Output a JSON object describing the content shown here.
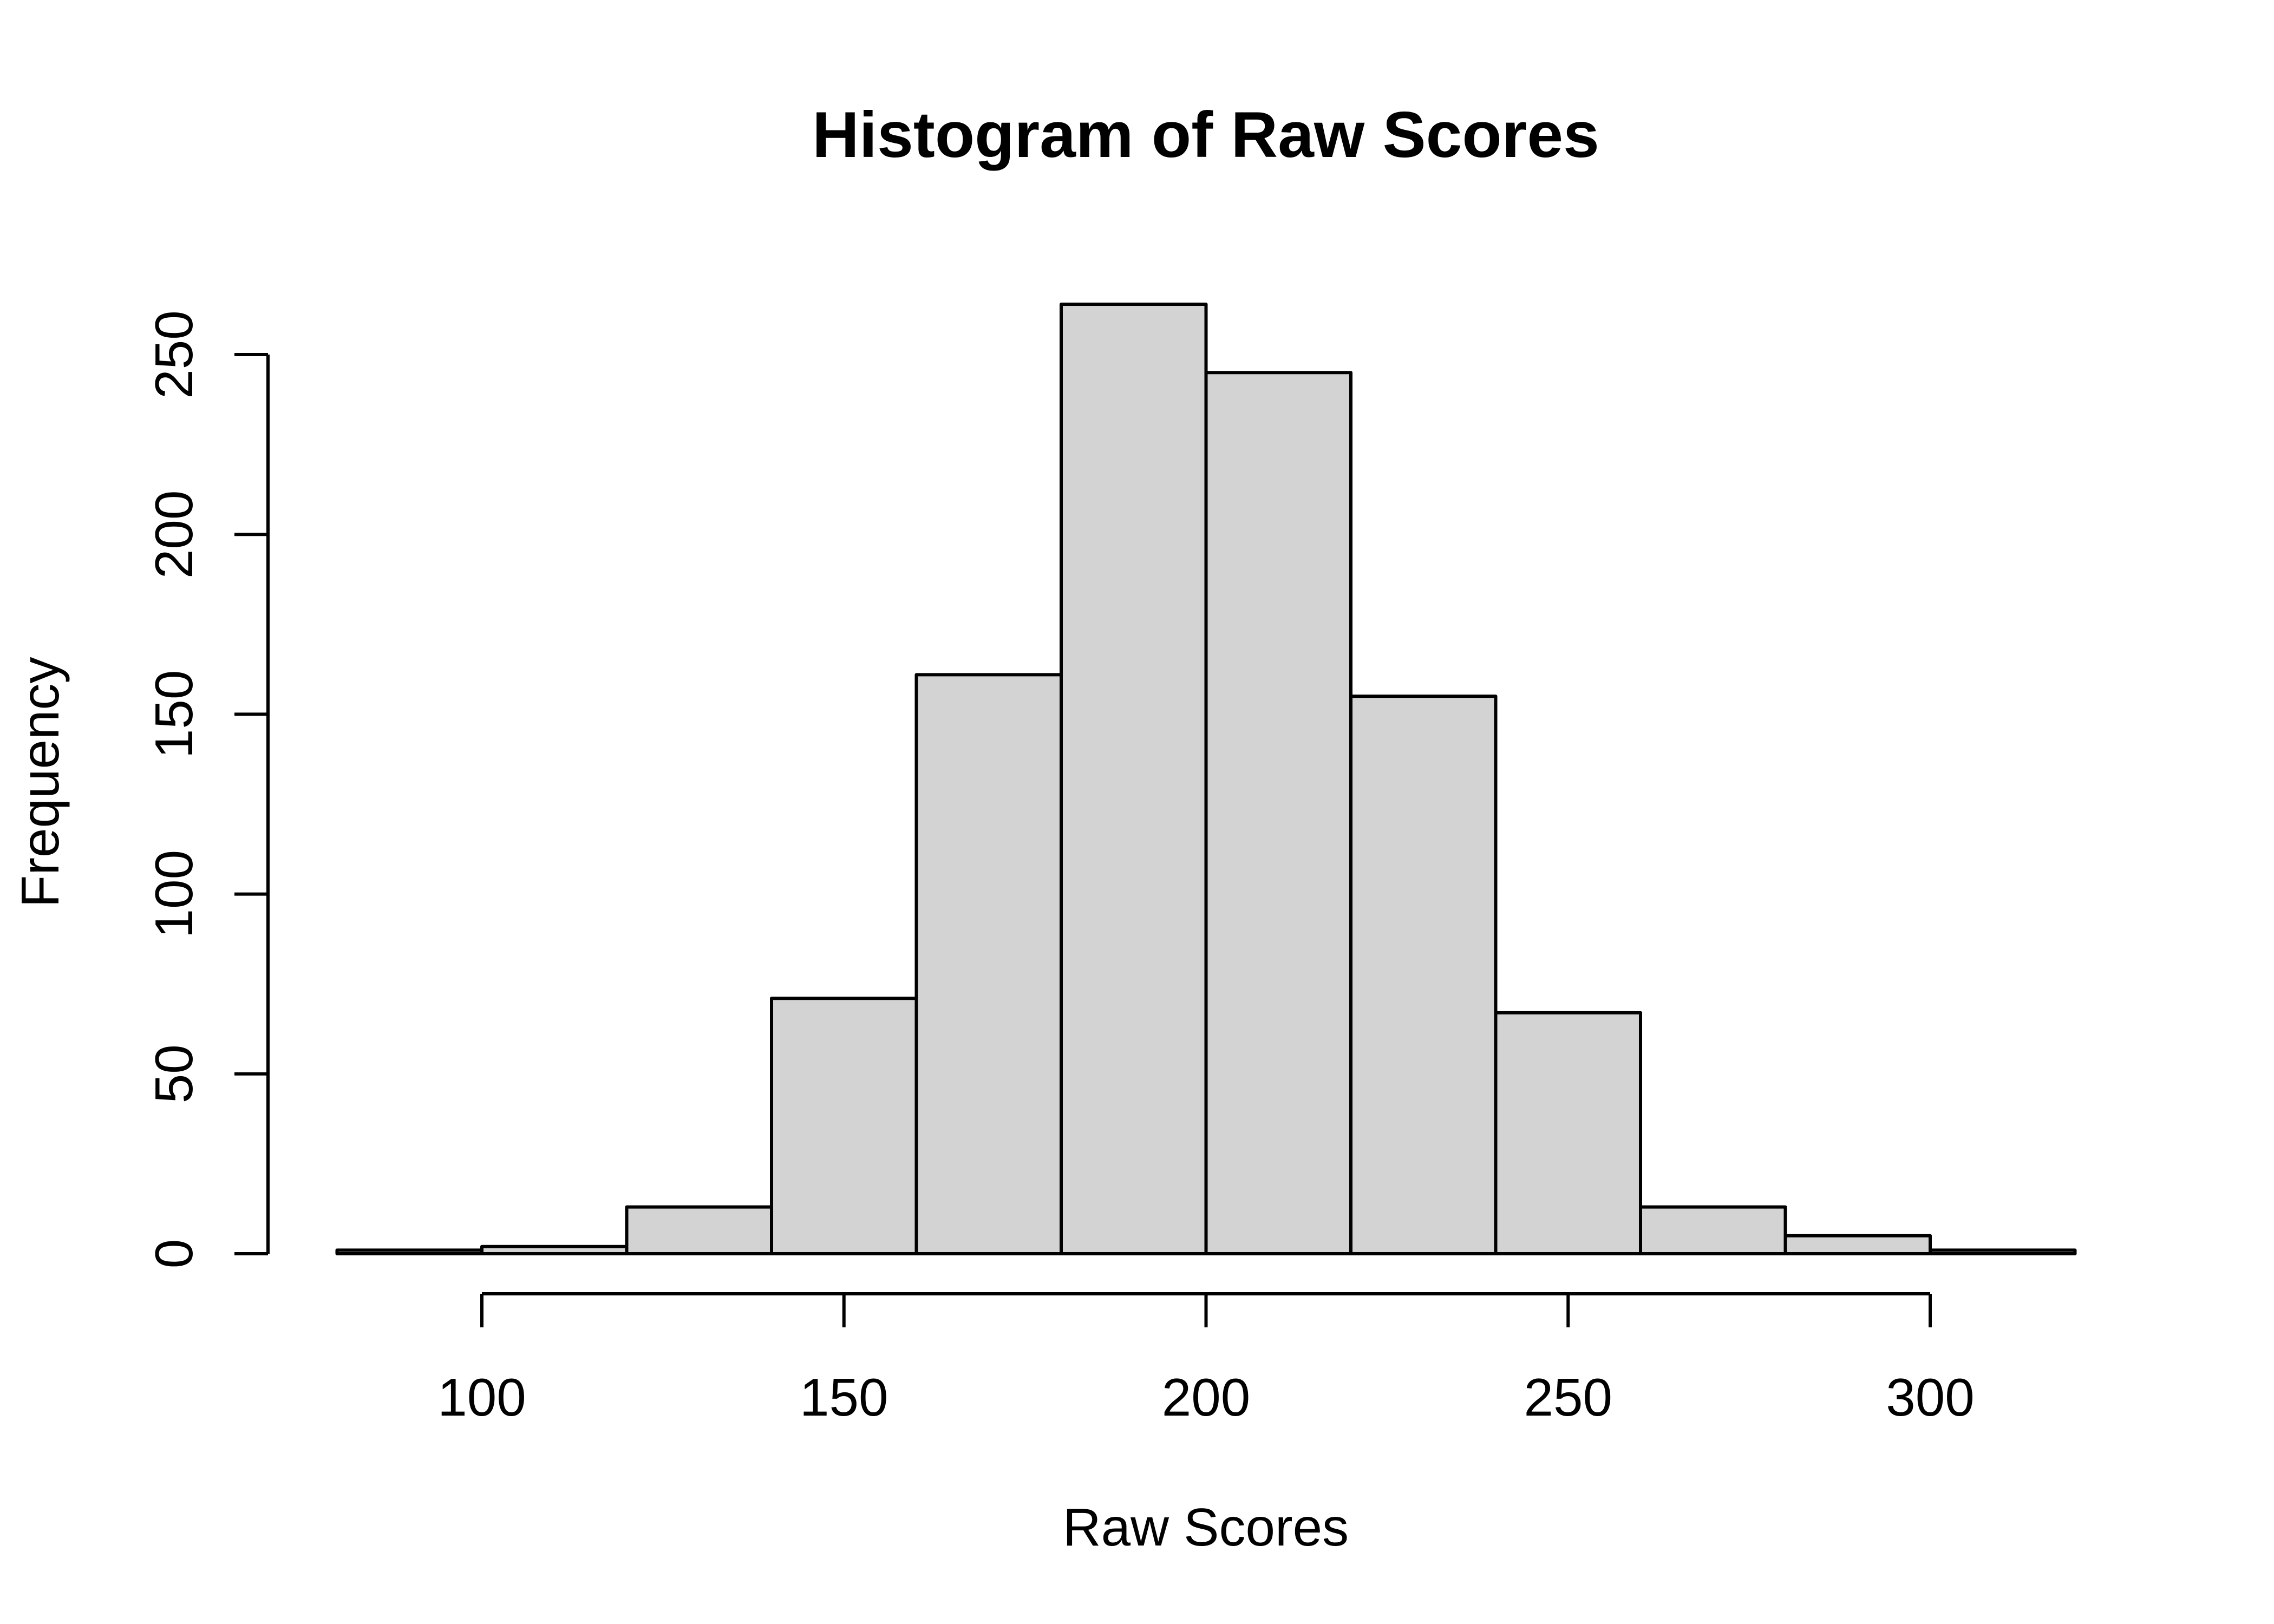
{
  "chart_data": {
    "type": "bar",
    "subtype": "histogram",
    "title": "Histogram of Raw Scores",
    "xlabel": "Raw Scores",
    "ylabel": "Frequency",
    "bin_edges": [
      80,
      100,
      120,
      140,
      160,
      180,
      200,
      220,
      240,
      260,
      280,
      300,
      320
    ],
    "counts": [
      1,
      2,
      13,
      71,
      161,
      264,
      245,
      155,
      67,
      13,
      5,
      1
    ],
    "xlim": [
      80,
      320
    ],
    "ylim": [
      0,
      264
    ],
    "x_ticks": [
      100,
      150,
      200,
      250,
      300
    ],
    "x_tick_labels": [
      "100",
      "150",
      "200",
      "250",
      "300"
    ],
    "y_ticks": [
      0,
      50,
      100,
      150,
      200,
      250
    ],
    "y_tick_labels": [
      "0",
      "50",
      "100",
      "150",
      "200",
      "250"
    ],
    "grid": false,
    "legend": null,
    "bar_fill": "#d3d3d3",
    "bar_stroke": "#000000"
  }
}
